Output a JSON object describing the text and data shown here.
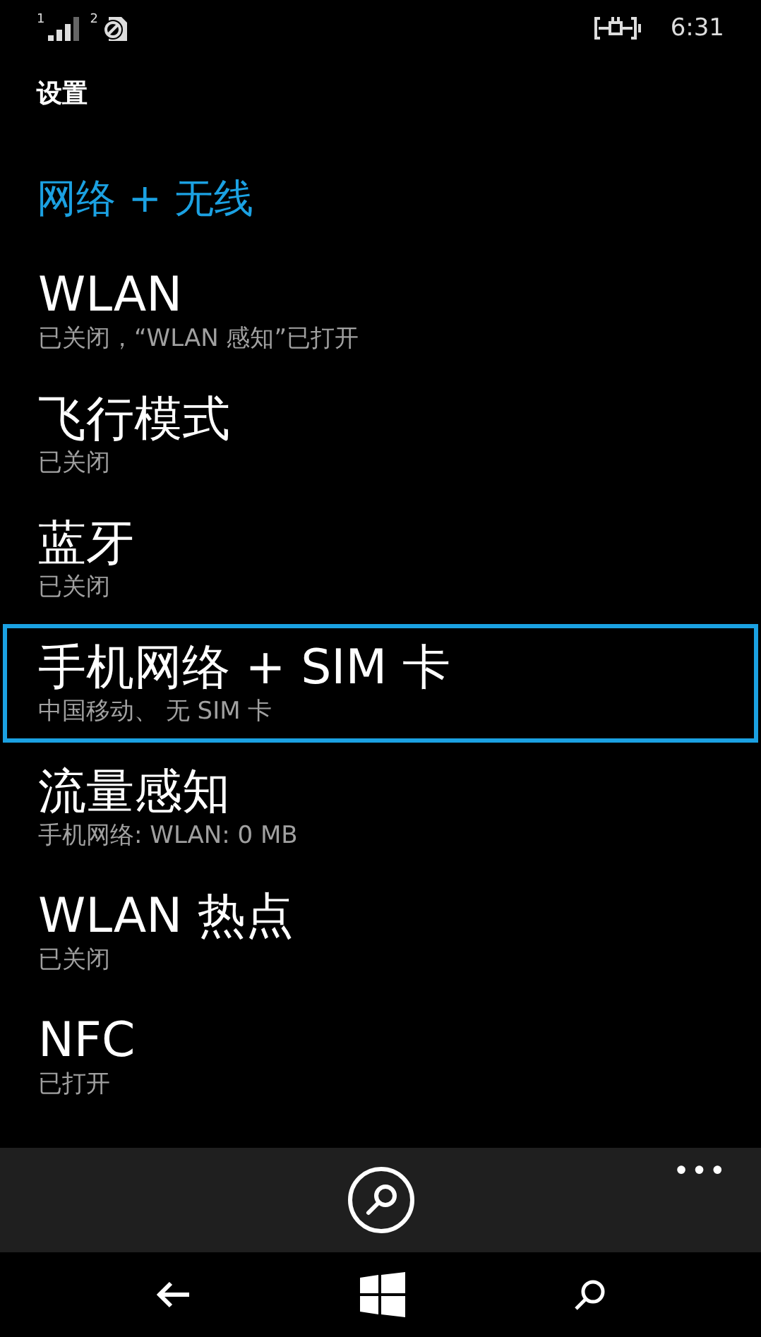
{
  "status_bar": {
    "sim_1": "1",
    "sim_2": "2",
    "time": "6:31"
  },
  "page_title": "设置",
  "section_title": "网络 + 无线",
  "items": [
    {
      "title": "WLAN",
      "subtitle": "已关闭，“WLAN 感知”已打开",
      "selected": false
    },
    {
      "title": "飞行模式",
      "subtitle": "已关闭",
      "selected": false
    },
    {
      "title": "蓝牙",
      "subtitle": "已关闭",
      "selected": false
    },
    {
      "title": "手机网络 + SIM 卡",
      "subtitle": "中国移动、 无 SIM 卡",
      "selected": true
    },
    {
      "title": "流量感知",
      "subtitle": "手机网络:  WLAN: 0 MB",
      "selected": false
    },
    {
      "title": "WLAN 热点",
      "subtitle": "已关闭",
      "selected": false
    },
    {
      "title": "NFC",
      "subtitle": "已打开",
      "selected": false
    }
  ],
  "app_bar": {
    "more": "•••"
  }
}
